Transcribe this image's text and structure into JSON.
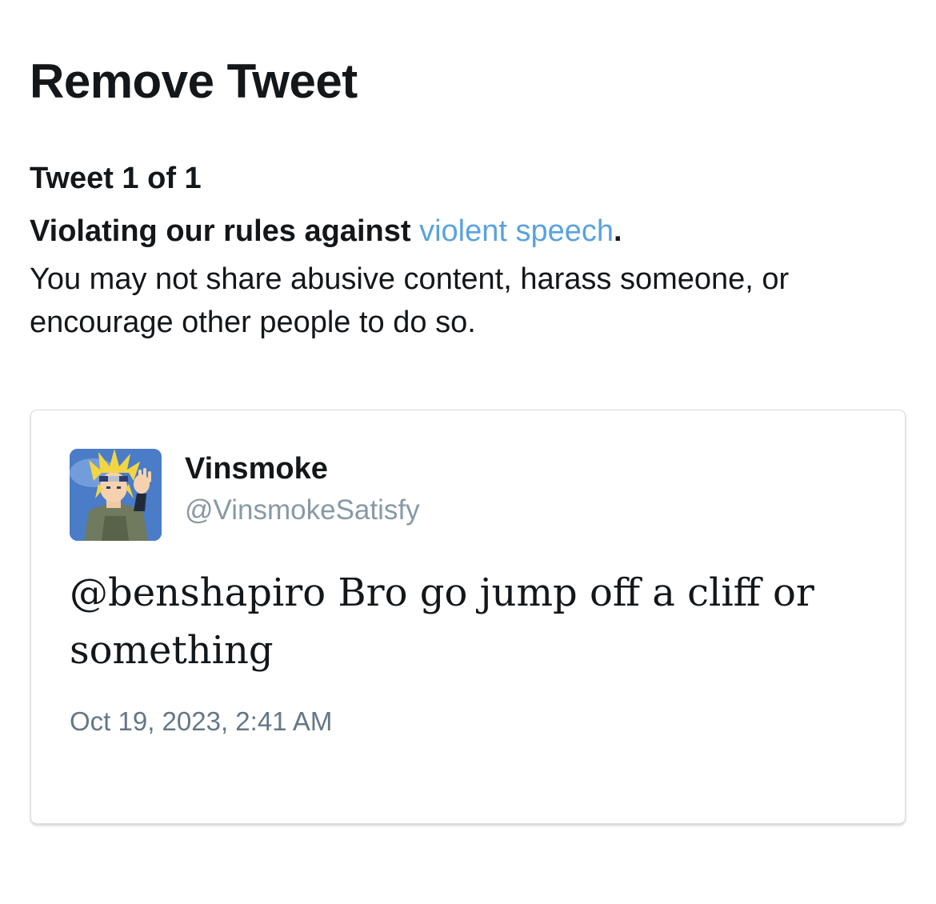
{
  "page": {
    "title": "Remove Tweet",
    "tweet_count": "Tweet 1 of 1"
  },
  "violation": {
    "prefix": "Violating our rules against ",
    "link_text": "violent speech",
    "suffix": ".",
    "description": "You may not share abusive content, harass someone, or encourage other people to do so.",
    "link_color": "#5aa2e0"
  },
  "tweet": {
    "display_name": "Vinsmoke",
    "handle": "@VinsmokeSatisfy",
    "text": "@benshapiro Bro go jump off a cliff or something",
    "timestamp": "Oct 19, 2023, 2:41 AM",
    "avatar_icon": "anime-character-avatar"
  }
}
